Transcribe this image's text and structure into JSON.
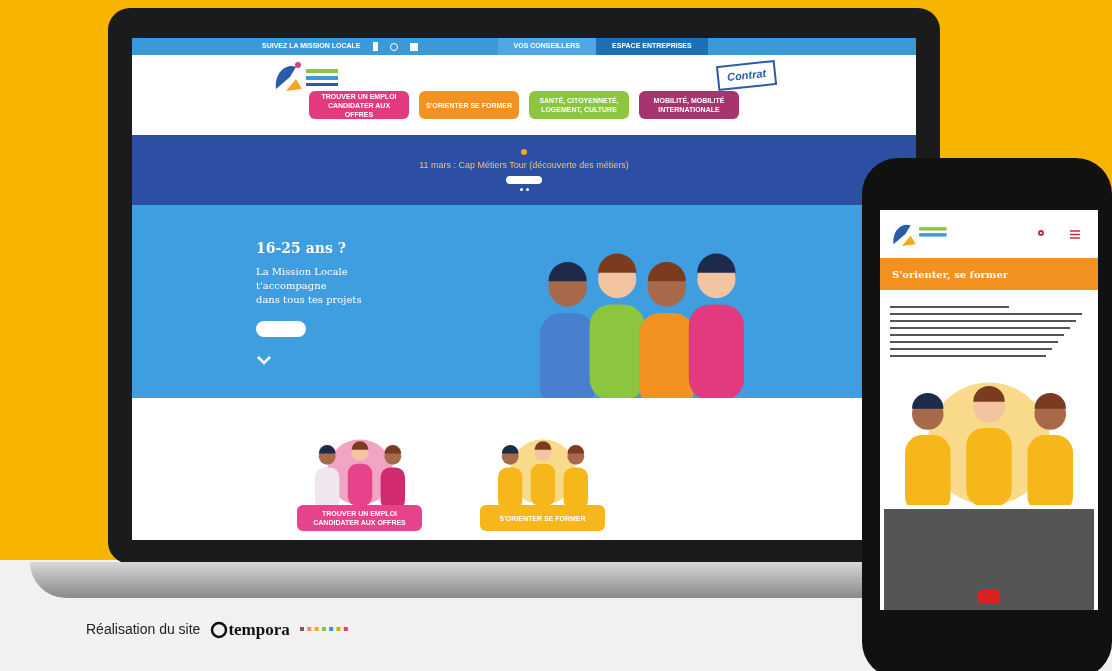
{
  "laptop": {
    "topbar": {
      "follow": "SUIVEZ LA MISSION LOCALE",
      "links": [
        {
          "label": "VOS CONSEILLERS",
          "selected": false
        },
        {
          "label": "ESPACE ENTREPRISES",
          "selected": true
        }
      ]
    },
    "badge": "Contrat",
    "nav": [
      {
        "label": "TROUVER UN EMPLOI CANDIDATER AUX OFFRES",
        "color": "#e3397e"
      },
      {
        "label": "S'ORIENTER SE FORMER",
        "color": "#f39220"
      },
      {
        "label": "SANTÉ, CITOYENNETÉ, LOGEMENT, CULTURE",
        "color": "#8cc63f"
      },
      {
        "label": "MOBILITÉ, MOBILITÉ INTERNATIONALE",
        "color": "#a8346f"
      }
    ],
    "banner": {
      "title": "11 mars : Cap Métiers Tour (découverte des métiers)"
    },
    "hero": {
      "title": "16-25 ans ?",
      "lines": [
        "La Mission Locale",
        "t'accompagne",
        "dans tous tes projets"
      ]
    },
    "cards": [
      {
        "label": "TROUVER UN EMPLOI CANDIDATER AUX OFFRES",
        "color": "#e6438a"
      },
      {
        "label": "S'ORIENTER SE FORMER",
        "color": "#f5b719"
      }
    ]
  },
  "phone": {
    "title": "S'orienter, se former"
  },
  "credit": {
    "text": "Réalisation du site",
    "brand": "tempora"
  }
}
